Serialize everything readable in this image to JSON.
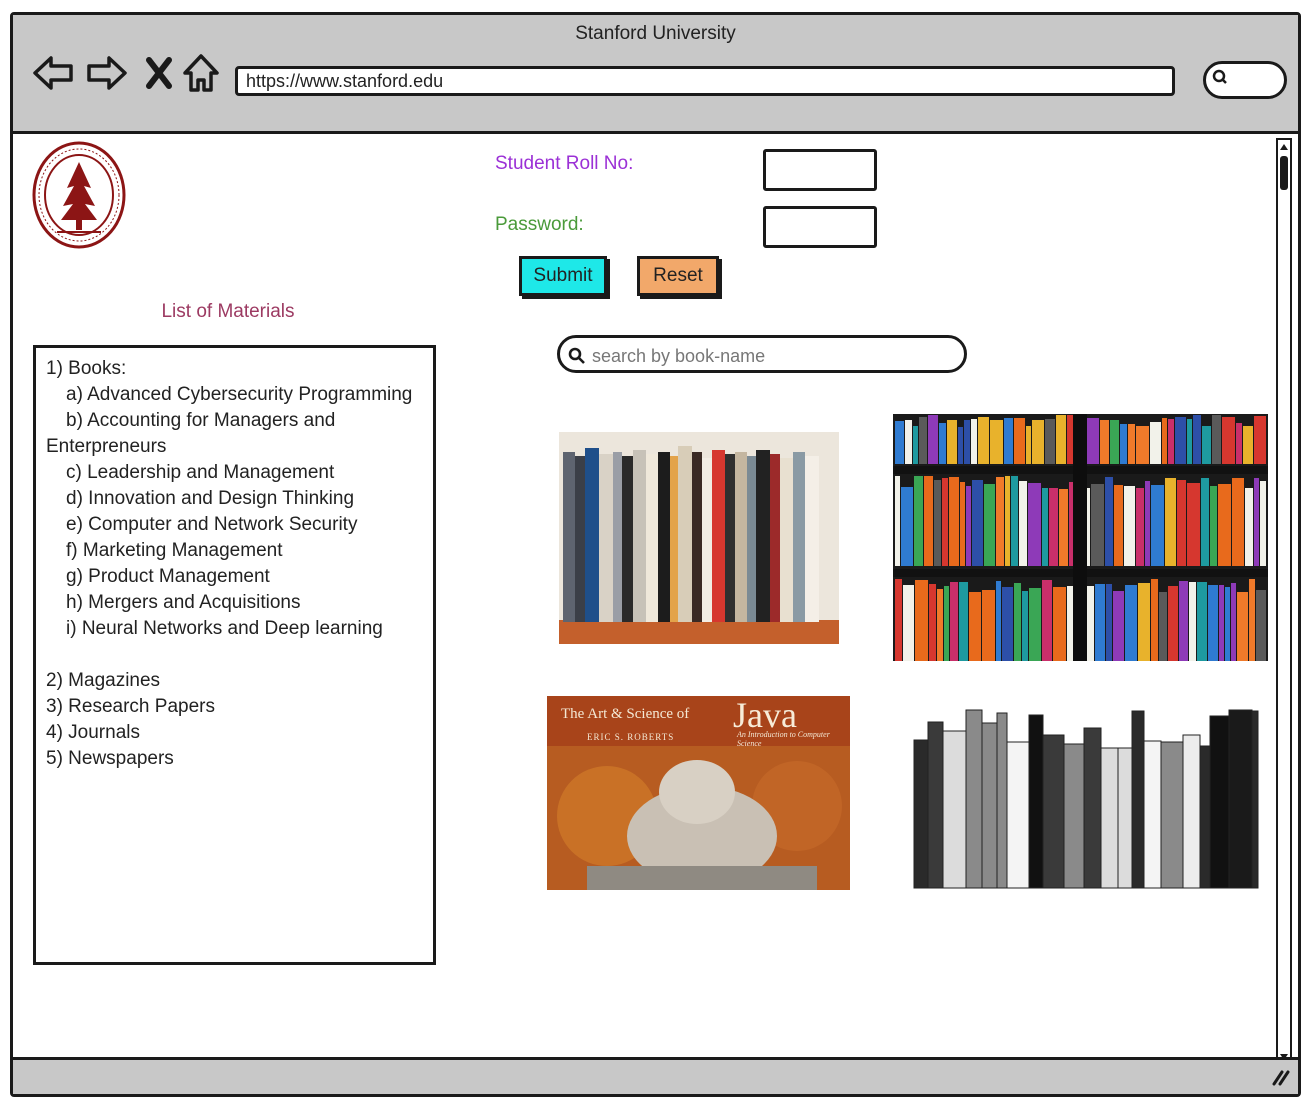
{
  "window": {
    "title": "Stanford University"
  },
  "address_bar": {
    "url": "https://www.stanford.edu"
  },
  "login": {
    "roll_label": "Student Roll No:",
    "password_label": "Password:",
    "submit_label": "Submit",
    "reset_label": "Reset"
  },
  "search": {
    "placeholder": "search by book-name"
  },
  "materials": {
    "title": "List of Materials",
    "books_heading": "1) Books:",
    "books": [
      "a) Advanced Cybersecurity Programming",
      "b) Accounting for Managers and",
      "Enterpreneurs",
      "c) Leadership and Management",
      "d) Innovation and Design Thinking",
      "e) Computer and Network Security",
      "f) Marketing Management",
      "g) Product Management",
      "h) Mergers and Acquisitions",
      "i) Neural Networks and Deep learning"
    ],
    "others": [
      "2) Magazines",
      "3) Research Papers",
      "4) Journals",
      "5) Newspapers"
    ]
  },
  "book_cover": {
    "title_prefix": "The Art & Science of",
    "title_main": "Java",
    "subtitle": "An Introduction to Computer Science",
    "author": "ERIC S. ROBERTS"
  },
  "colors": {
    "roll_label": "#9b30d6",
    "password_label": "#4a9a3a",
    "list_title": "#9c3a62",
    "submit_bg": "#1ee8e8",
    "reset_bg": "#f2a86a",
    "chrome": "#c8c8c8"
  }
}
